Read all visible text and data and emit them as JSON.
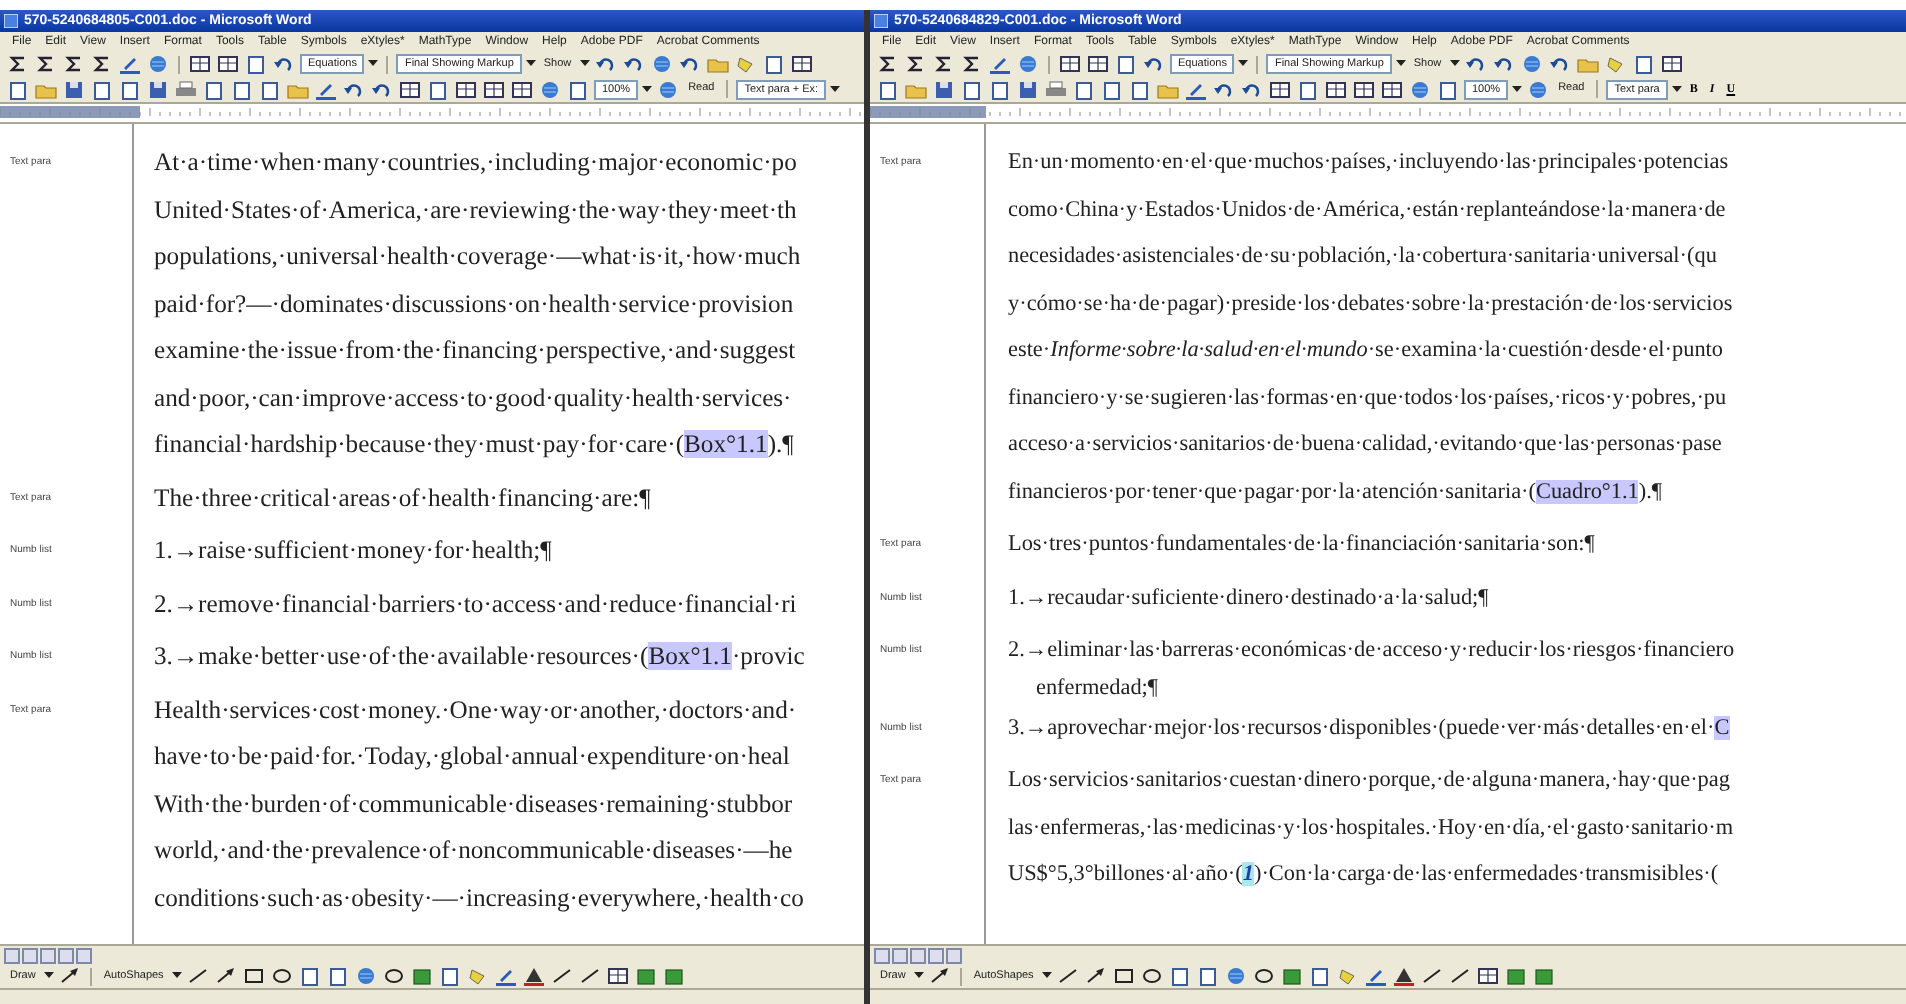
{
  "windows": [
    {
      "title": "570-5240684805-C001.doc - Microsoft Word",
      "menu": [
        "File",
        "Edit",
        "View",
        "Insert",
        "Format",
        "Tools",
        "Table",
        "Symbols",
        "eXtyles*",
        "MathType",
        "Window",
        "Help",
        "Adobe PDF",
        "Acrobat Comments"
      ],
      "equations": "Equations",
      "markup": "Final Showing Markup",
      "show": "Show",
      "zoom": "100%",
      "read": "Read",
      "style": "Text para + Ex:",
      "paragraphs": [
        {
          "style": "Text para",
          "kind": "text",
          "lines": [
            "At·a·time·when·many·countries,·including·major·economic·po",
            "United·States·of·America,·are·reviewing·the·way·they·meet·th",
            "populations,·universal·health·coverage·—what·is·it,·how·much",
            "paid·for?—·dominates·discussions·on·health·service·provision",
            "examine·the·issue·from·the·financing·perspective,·and·suggest",
            "and·poor,·can·improve·access·to·good·quality·health·services·",
            [
              {
                "kind": "text",
                "text": "financial·hardship·because·they·must·pay·for·care·("
              },
              {
                "kind": "field",
                "text": "Box°1.1"
              },
              {
                "kind": "text",
                "text": ").¶"
              }
            ]
          ]
        },
        {
          "style": "Text para",
          "kind": "text",
          "lines": [
            "The·three·critical·areas·of·health·financing·are:¶"
          ]
        },
        {
          "style": "Numb list",
          "kind": "list",
          "lines": [
            "1.→raise·sufficient·money·for·health;¶"
          ]
        },
        {
          "style": "Numb list",
          "kind": "list",
          "lines": [
            "2.→remove·financial·barriers·to·access·and·reduce·financial·ri"
          ]
        },
        {
          "style": "Numb list",
          "kind": "list",
          "lines": [
            [
              {
                "kind": "text",
                "text": "3.→make·better·use·of·the·available·resources·("
              },
              {
                "kind": "field",
                "text": "Box°1.1"
              },
              {
                "kind": "text",
                "text": "·provic"
              }
            ]
          ]
        },
        {
          "style": "Text para",
          "kind": "text",
          "lines": [
            "Health·services·cost·money.·One·way·or·another,·doctors·and·",
            "have·to·be·paid·for.·Today,·global·annual·expenditure·on·heal",
            "With·the·burden·of·communicable·diseases·remaining·stubbor",
            "world,·and·the·prevalence·of·noncommunicable·diseases·—he",
            "conditions·such·as·obesity·—·increasing·everywhere,·health·co"
          ]
        }
      ],
      "draw": "Draw",
      "autoshapes": "AutoShapes"
    },
    {
      "title": "570-5240684829-C001.doc - Microsoft Word",
      "menu": [
        "File",
        "Edit",
        "View",
        "Insert",
        "Format",
        "Tools",
        "Table",
        "Symbols",
        "eXtyles*",
        "MathType",
        "Window",
        "Help",
        "Adobe PDF",
        "Acrobat Comments"
      ],
      "equations": "Equations",
      "markup": "Final Showing Markup",
      "show": "Show",
      "zoom": "100%",
      "read": "Read",
      "style": "Text para",
      "format_buttons": [
        "B",
        "I",
        "U"
      ],
      "paragraphs": [
        {
          "style": "Text para",
          "kind": "text",
          "lines": [
            "En·un·momento·en·el·que·muchos·países,·incluyendo·las·principales·potencias",
            "como·China·y·Estados·Unidos·de·América,·están·replanteándose·la·manera·de",
            "necesidades·asistenciales·de·su·población,·la·cobertura·sanitaria·universal·(qu",
            "y·cómo·se·ha·de·pagar)·preside·los·debates·sobre·la·prestación·de·los·servicios",
            "este·*Informe·sobre·la·salud·en·el·mundo*·se·examina·la·cuestión·desde·el·punto",
            "financiero·y·se·sugieren·las·formas·en·que·todos·los·países,·ricos·y·pobres,·pu",
            "acceso·a·servicios·sanitarios·de·buena·calidad,·evitando·que·las·personas·pase",
            [
              {
                "kind": "text",
                "text": "financieros·por·tener·que·pagar·por·la·atención·sanitaria·("
              },
              {
                "kind": "field",
                "text": "Cuadro°1.1"
              },
              {
                "kind": "text",
                "text": ").¶"
              }
            ]
          ]
        },
        {
          "style": "Text para",
          "kind": "text",
          "lines": [
            "Los·tres·puntos·fundamentales·de·la·financiación·sanitaria·son:¶"
          ]
        },
        {
          "style": "Numb list",
          "kind": "list",
          "lines": [
            "1.→recaudar·suficiente·dinero·destinado·a·la·salud;¶"
          ]
        },
        {
          "style": "Numb list",
          "kind": "list",
          "lines": [
            "2.→eliminar·las·barreras·económicas·de·acceso·y·reducir·los·riesgos·financiero",
            "enfermedad;¶"
          ]
        },
        {
          "style": "Numb list",
          "kind": "list",
          "lines": [
            [
              {
                "kind": "text",
                "text": "3.→aprovechar·mejor·los·recursos·disponibles·(puede·ver·más·detalles·en·el·"
              },
              {
                "kind": "field",
                "text": "C"
              }
            ]
          ]
        },
        {
          "style": "Text para",
          "kind": "text",
          "lines": [
            "Los·servicios·sanitarios·cuestan·dinero·porque,·de·alguna·manera,·hay·que·pag",
            "las·enfermeras,·las·medicinas·y·los·hospitales.·Hoy·en·día,·el·gasto·sanitario·m",
            [
              {
                "kind": "text",
                "text": "US$°5,3°billones·al·año·("
              },
              {
                "kind": "ref",
                "text": "1"
              },
              {
                "kind": "text",
                "text": ")·Con·la·carga·de·las·enfermedades·transmisibles·("
              }
            ]
          ]
        }
      ],
      "draw": "Draw",
      "autoshapes": "AutoShapes"
    }
  ]
}
